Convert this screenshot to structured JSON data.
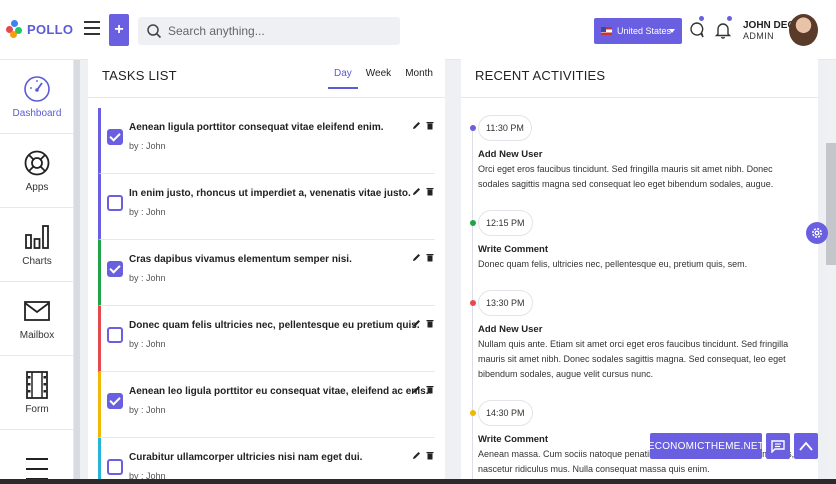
{
  "brand": {
    "name": "POLLO",
    "colors": {
      "accent": "#6a5fe0",
      "logo_red": "#e5484d",
      "logo_blue": "#3b82f6",
      "logo_green": "#22c55e",
      "logo_orange": "#f59e0b"
    }
  },
  "header": {
    "search_placeholder": "Search anything...",
    "country": "United States",
    "user_name": "JOHN DEO",
    "user_role": "ADMIN"
  },
  "sidebar": {
    "items": [
      {
        "label": "Dashboard",
        "icon": "dashboard-gauge-icon",
        "active": true
      },
      {
        "label": "Apps",
        "icon": "lifebuoy-icon"
      },
      {
        "label": "Charts",
        "icon": "bar-chart-icon"
      },
      {
        "label": "Mailbox",
        "icon": "mail-icon"
      },
      {
        "label": "Form",
        "icon": "film-form-icon"
      },
      {
        "label": "",
        "icon": "menu-icon"
      }
    ]
  },
  "tasks": {
    "title": "TASKS LIST",
    "tabs": [
      "Day",
      "Week",
      "Month"
    ],
    "active_tab": "Day",
    "items": [
      {
        "title": "Aenean ligula porttitor consequat vitae eleifend enim.",
        "by": "by : John",
        "checked": true,
        "color": "#6a5fe0"
      },
      {
        "title": "In enim justo, rhoncus ut imperdiet a, venenatis vitae justo.",
        "by": "by : John",
        "checked": false,
        "color": "#6a5fe0"
      },
      {
        "title": "Cras dapibus vivamus elementum semper nisi.",
        "by": "by : John",
        "checked": true,
        "color": "#22a347"
      },
      {
        "title": "Donec quam felis ultricies nec, pellentesque eu pretium quis.",
        "by": "by : John",
        "checked": false,
        "color": "#e5484d"
      },
      {
        "title": "Aenean leo ligula porttitor eu consequat vitae, eleifend ac enis.",
        "by": "by : John",
        "checked": true,
        "color": "#f2b705"
      },
      {
        "title": "Curabitur ullamcorper ultricies nisi nam eget dui.",
        "by": "by : John",
        "checked": false,
        "color": "#26b5d9"
      }
    ]
  },
  "activities": {
    "title": "RECENT ACTIVITIES",
    "items": [
      {
        "time": "11:30 PM",
        "dot": "#6a5fe0",
        "title": "Add New User",
        "text": "Orci eget eros faucibus tincidunt. Sed fringilla mauris sit amet nibh. Donec sodales sagittis magna sed consequat leo eget bibendum sodales, augue."
      },
      {
        "time": "12:15 PM",
        "dot": "#22a347",
        "title": "Write Comment",
        "text": "Donec quam felis, ultricies nec, pellentesque eu, pretium quis, sem."
      },
      {
        "time": "13:30 PM",
        "dot": "#e5484d",
        "title": "Add New User",
        "text": "Nullam quis ante. Etiam sit amet orci eget eros faucibus tincidunt. Sed fringilla mauris sit amet nibh. Donec sodales sagittis magna. Sed consequat, leo eget bibendum sodales, augue velit cursus nunc."
      },
      {
        "time": "14:30 PM",
        "dot": "#f2b705",
        "title": "Write Comment",
        "text": "Aenean massa. Cum sociis natoque penatibus et magnis dis parturient montes, nascetur ridiculus mus. Nulla consequat massa quis enim."
      }
    ]
  },
  "promo_label": "ECONOMICTHEME.NET"
}
